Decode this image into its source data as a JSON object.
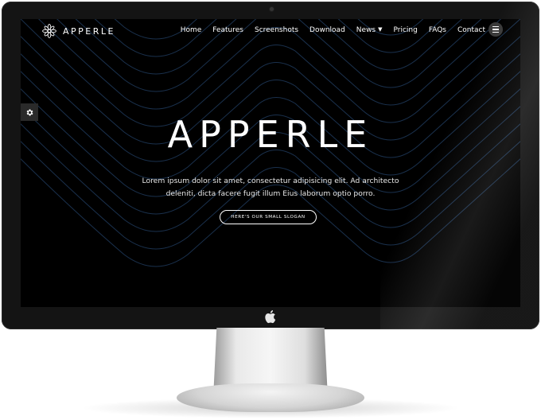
{
  "site": {
    "brand": "APPERLE",
    "nav": [
      {
        "label": "Home"
      },
      {
        "label": "Features"
      },
      {
        "label": "Screenshots"
      },
      {
        "label": "Download"
      },
      {
        "label": "News"
      },
      {
        "label": "Pricing"
      },
      {
        "label": "FAQs"
      },
      {
        "label": "Contact"
      }
    ],
    "hero": {
      "title": "APPERLE",
      "text": "Lorem ipsum dolor sit amet, consectetur adipisicing elit. Ad architecto deleniti, dicta facere fugit illum Eius laborum optio porro.",
      "button_label": "HERE'S OUR SMALL SLOGAN"
    }
  },
  "icons": {
    "brand": "mandala-logo-icon",
    "menu": "hamburger-icon",
    "settings": "gear-icon",
    "dropdown": "chevron-down-icon",
    "device": "apple-logo-icon"
  },
  "colors": {
    "screen_bg": "#000000",
    "wave_line": "#1f3a5c",
    "text": "#ffffff",
    "bezel": "#141414"
  }
}
